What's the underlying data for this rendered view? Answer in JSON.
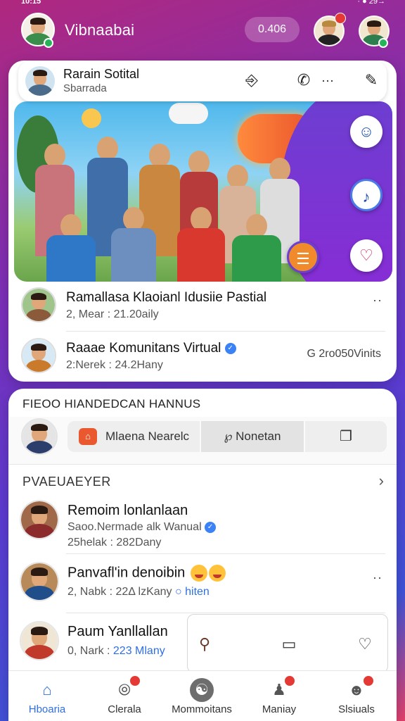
{
  "status_bar": {
    "time": "10:15",
    "right": "· ● 29→"
  },
  "top_bar": {
    "title": "Vibnaabai",
    "counter": "0.406"
  },
  "group": {
    "name": "Rarain Sotital",
    "subtitle": "Sbarrada"
  },
  "posts": [
    {
      "title": "Ramallasa Klaoianl Idusiie Pastial",
      "meta": "2, Mear : 21.20aily"
    },
    {
      "title": "Raaae Komunitans Virtual",
      "meta": "2:Nerek : 24.2Hany",
      "right_note": "G 2ro050Vinits"
    }
  ],
  "friends": {
    "section_title": "FIEOO HIANDEDCAN HANNUS",
    "seg_a": "Mlaena Nearelc",
    "seg_b": "℘ Nonetan"
  },
  "people": {
    "title": "PVAEUAEYER",
    "rows": [
      {
        "name": "Remoim lonlanlaan",
        "sub": "Saoo.Nermade alk Wanual",
        "sub2": "25helak : 282Dany"
      },
      {
        "name": "Panvafl'in denoibin",
        "sub": "2, Nabk : 22Δ lzKany",
        "link": "hiten"
      },
      {
        "name": "Paum Yanllallan",
        "sub": "0, Nark : ",
        "link": "223 Mlany"
      }
    ]
  },
  "nav": [
    {
      "label": "Hboaria",
      "icon": "home-icon"
    },
    {
      "label": "Clerala",
      "icon": "compass-icon"
    },
    {
      "label": "Mommoitans",
      "icon": "community-icon"
    },
    {
      "label": "Maniay",
      "icon": "people-icon"
    },
    {
      "label": "Slsiuals",
      "icon": "profile-icon"
    }
  ],
  "colors": {
    "accent": "#2f6fe4",
    "badge": "#e53935",
    "online": "#25b45a"
  }
}
